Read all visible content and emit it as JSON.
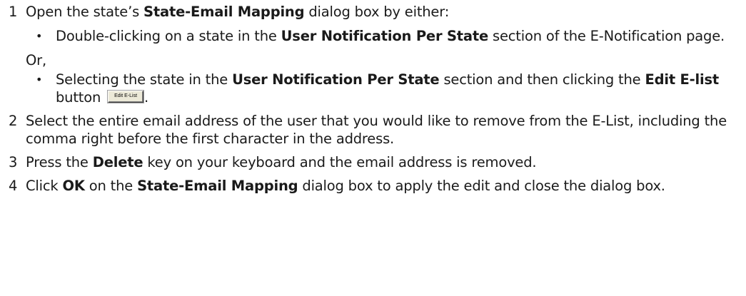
{
  "steps": [
    {
      "number": "1",
      "pre": "Open the state’s ",
      "bold1": "State-Email Mapping",
      "post": " dialog box by either:"
    },
    {
      "number": "2",
      "text": "Select the entire email address of the user that you would like to remove from the E-List, including the comma right before the first character in the address."
    },
    {
      "number": "3",
      "pre": "Press the ",
      "bold1": "Delete",
      "post": " key on your keyboard and the email address is removed."
    },
    {
      "number": "4",
      "pre": "Click ",
      "bold1": "OK",
      "mid": " on the ",
      "bold2": "State-Email Mapping",
      "post": " dialog box to apply the edit and close the dialog box."
    }
  ],
  "bullets": [
    {
      "dot": "•",
      "pre": "Double-clicking on a state in the ",
      "bold1": "User Notification Per State",
      "post": " section of the E-Notification page."
    },
    {
      "dot": "•",
      "pre": "Selecting the state in the ",
      "bold1": "User Notification Per State",
      "mid": " section and then clicking the ",
      "bold2": "Edit E-list",
      "mid2": " button ",
      "button_label": "Edit E-List",
      "post": "."
    }
  ],
  "or_text": "Or,"
}
